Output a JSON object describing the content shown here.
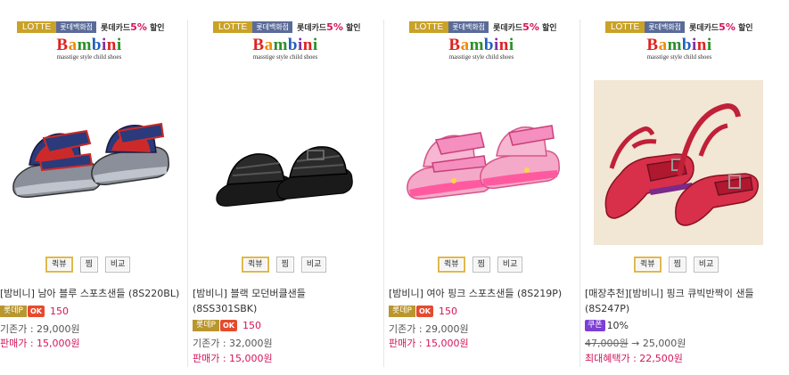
{
  "products": [
    {
      "badge": {
        "lotte": "LOTTE",
        "store": "롯데백화점",
        "card_prefix": "롯데카드",
        "card_pct": "5%",
        "card_suffix": " 할인"
      },
      "logo": {
        "word": "Bambini",
        "tagline": "masstige style child shoes"
      },
      "buttons": {
        "quick": "퀵뷰",
        "wish": "찜",
        "compare": "비교"
      },
      "name_line1": "[밤비니] 남아 블루 스포츠샌들 (8S220BL)",
      "name_line2": "",
      "points": {
        "label": "롯데P",
        "ok": "OK",
        "value": "150"
      },
      "base_price": "기존가 : 29,000원",
      "sale_price": "판매가 : 15,000원"
    },
    {
      "badge": {
        "lotte": "LOTTE",
        "store": "롯데백화점",
        "card_prefix": "롯데카드",
        "card_pct": "5%",
        "card_suffix": " 할인"
      },
      "logo": {
        "word": "Bambini",
        "tagline": "masstige style child shoes"
      },
      "buttons": {
        "quick": "퀵뷰",
        "wish": "찜",
        "compare": "비교"
      },
      "name_line1": "[밤비니] 블랙 모던버클샌들",
      "name_line2": "(8SS301SBK)",
      "points": {
        "label": "롯데P",
        "ok": "OK",
        "value": "150"
      },
      "base_price": "기존가 : 32,000원",
      "sale_price": "판매가 : 15,000원"
    },
    {
      "badge": {
        "lotte": "LOTTE",
        "store": "롯데백화점",
        "card_prefix": "롯데카드",
        "card_pct": "5%",
        "card_suffix": " 할인"
      },
      "logo": {
        "word": "Bambini",
        "tagline": "masstige style child shoes"
      },
      "buttons": {
        "quick": "퀵뷰",
        "wish": "찜",
        "compare": "비교"
      },
      "name_line1": "[밤비니] 여아 핑크 스포츠샌들 (8S219P)",
      "name_line2": "",
      "points": {
        "label": "롯데P",
        "ok": "OK",
        "value": "150"
      },
      "base_price": "기존가 : 29,000원",
      "sale_price": "판매가 : 15,000원"
    },
    {
      "badge": {
        "lotte": "LOTTE",
        "store": "롯데백화점",
        "card_prefix": "롯데카드",
        "card_pct": "5%",
        "card_suffix": " 할인"
      },
      "logo": {
        "word": "Bambini",
        "tagline": "masstige style child shoes"
      },
      "buttons": {
        "quick": "퀵뷰",
        "wish": "찜",
        "compare": "비교"
      },
      "name_line1": "[매장추천][밤비니] 핑크 큐빅반짝이 샌들",
      "name_line2": "(8S247P)",
      "coupon": {
        "label": "쿠폰",
        "value": "10%"
      },
      "old_price": "47,000원",
      "arrow_price": " → 25,000원",
      "max_benefit": "최대혜택가 : 22,500원"
    }
  ],
  "colors": {
    "accent_pink": "#d4145a",
    "lotte_gold": "#c9a227",
    "store_blue": "#5b6b99",
    "coupon_purple": "#7d3fd6"
  }
}
